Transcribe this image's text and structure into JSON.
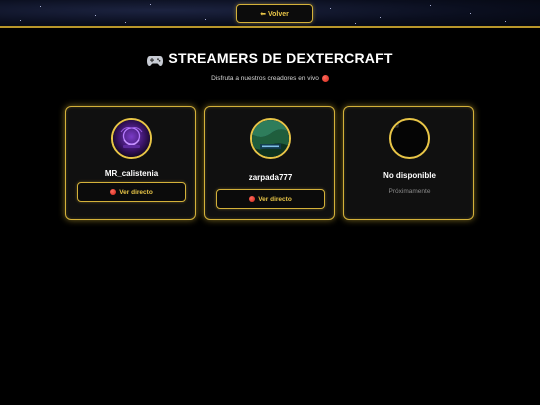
{
  "header": {
    "back_label": "⬅ Volver"
  },
  "main": {
    "title": "STREAMERS DE DEXTERCRAFT",
    "subtitle": "Disfruta a nuestros creadores en vivo"
  },
  "streamers": [
    {
      "name": "MR_calistenia",
      "button_label": "Ver directo",
      "status": "live"
    },
    {
      "name": "zarpada777",
      "button_label": "Ver directo",
      "status": "live"
    },
    {
      "name": "No disponible",
      "note": "Próximamente",
      "status": "unavailable"
    }
  ],
  "colors": {
    "accent_gold": "#e8c547",
    "background": "#000000",
    "card_background": "#101010",
    "live_red": "#d0261a"
  }
}
